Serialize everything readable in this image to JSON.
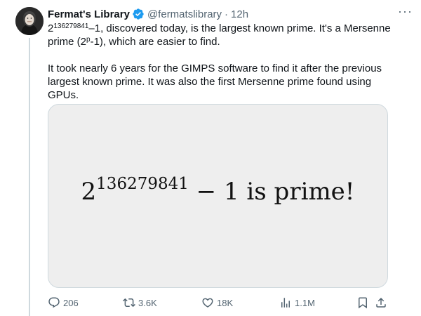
{
  "author": {
    "name": "Fermat's Library",
    "handle": "@fermatslibrary",
    "separator": "·",
    "time": "12h"
  },
  "menu": {
    "more_label": "···"
  },
  "body": {
    "p1_base": "2",
    "p1_exp": "136279841",
    "p1_text_a": "–1, discovered today, is the largest known prime. It's a Mersenne prime (2",
    "p1_exp2": "p",
    "p1_text_b": "-1), which are easier to find.",
    "p2": "It took nearly 6 years for the GIMPS software to find it after the previous largest known prime. It was also the first Mersenne prime found using GPUs."
  },
  "media": {
    "base": "2",
    "exponent": "136279841",
    "rest": " − 1 is prime!"
  },
  "actions": {
    "replies": "206",
    "retweets": "3.6K",
    "likes": "18K",
    "views": "1.1M"
  },
  "colors": {
    "verified": "#1d9bf0",
    "muted": "#536471",
    "media_bg": "#eeeeee"
  },
  "icons": [
    "verified-badge-icon",
    "more-icon",
    "reply-icon",
    "retweet-icon",
    "like-icon",
    "views-icon",
    "bookmark-icon",
    "share-icon"
  ]
}
